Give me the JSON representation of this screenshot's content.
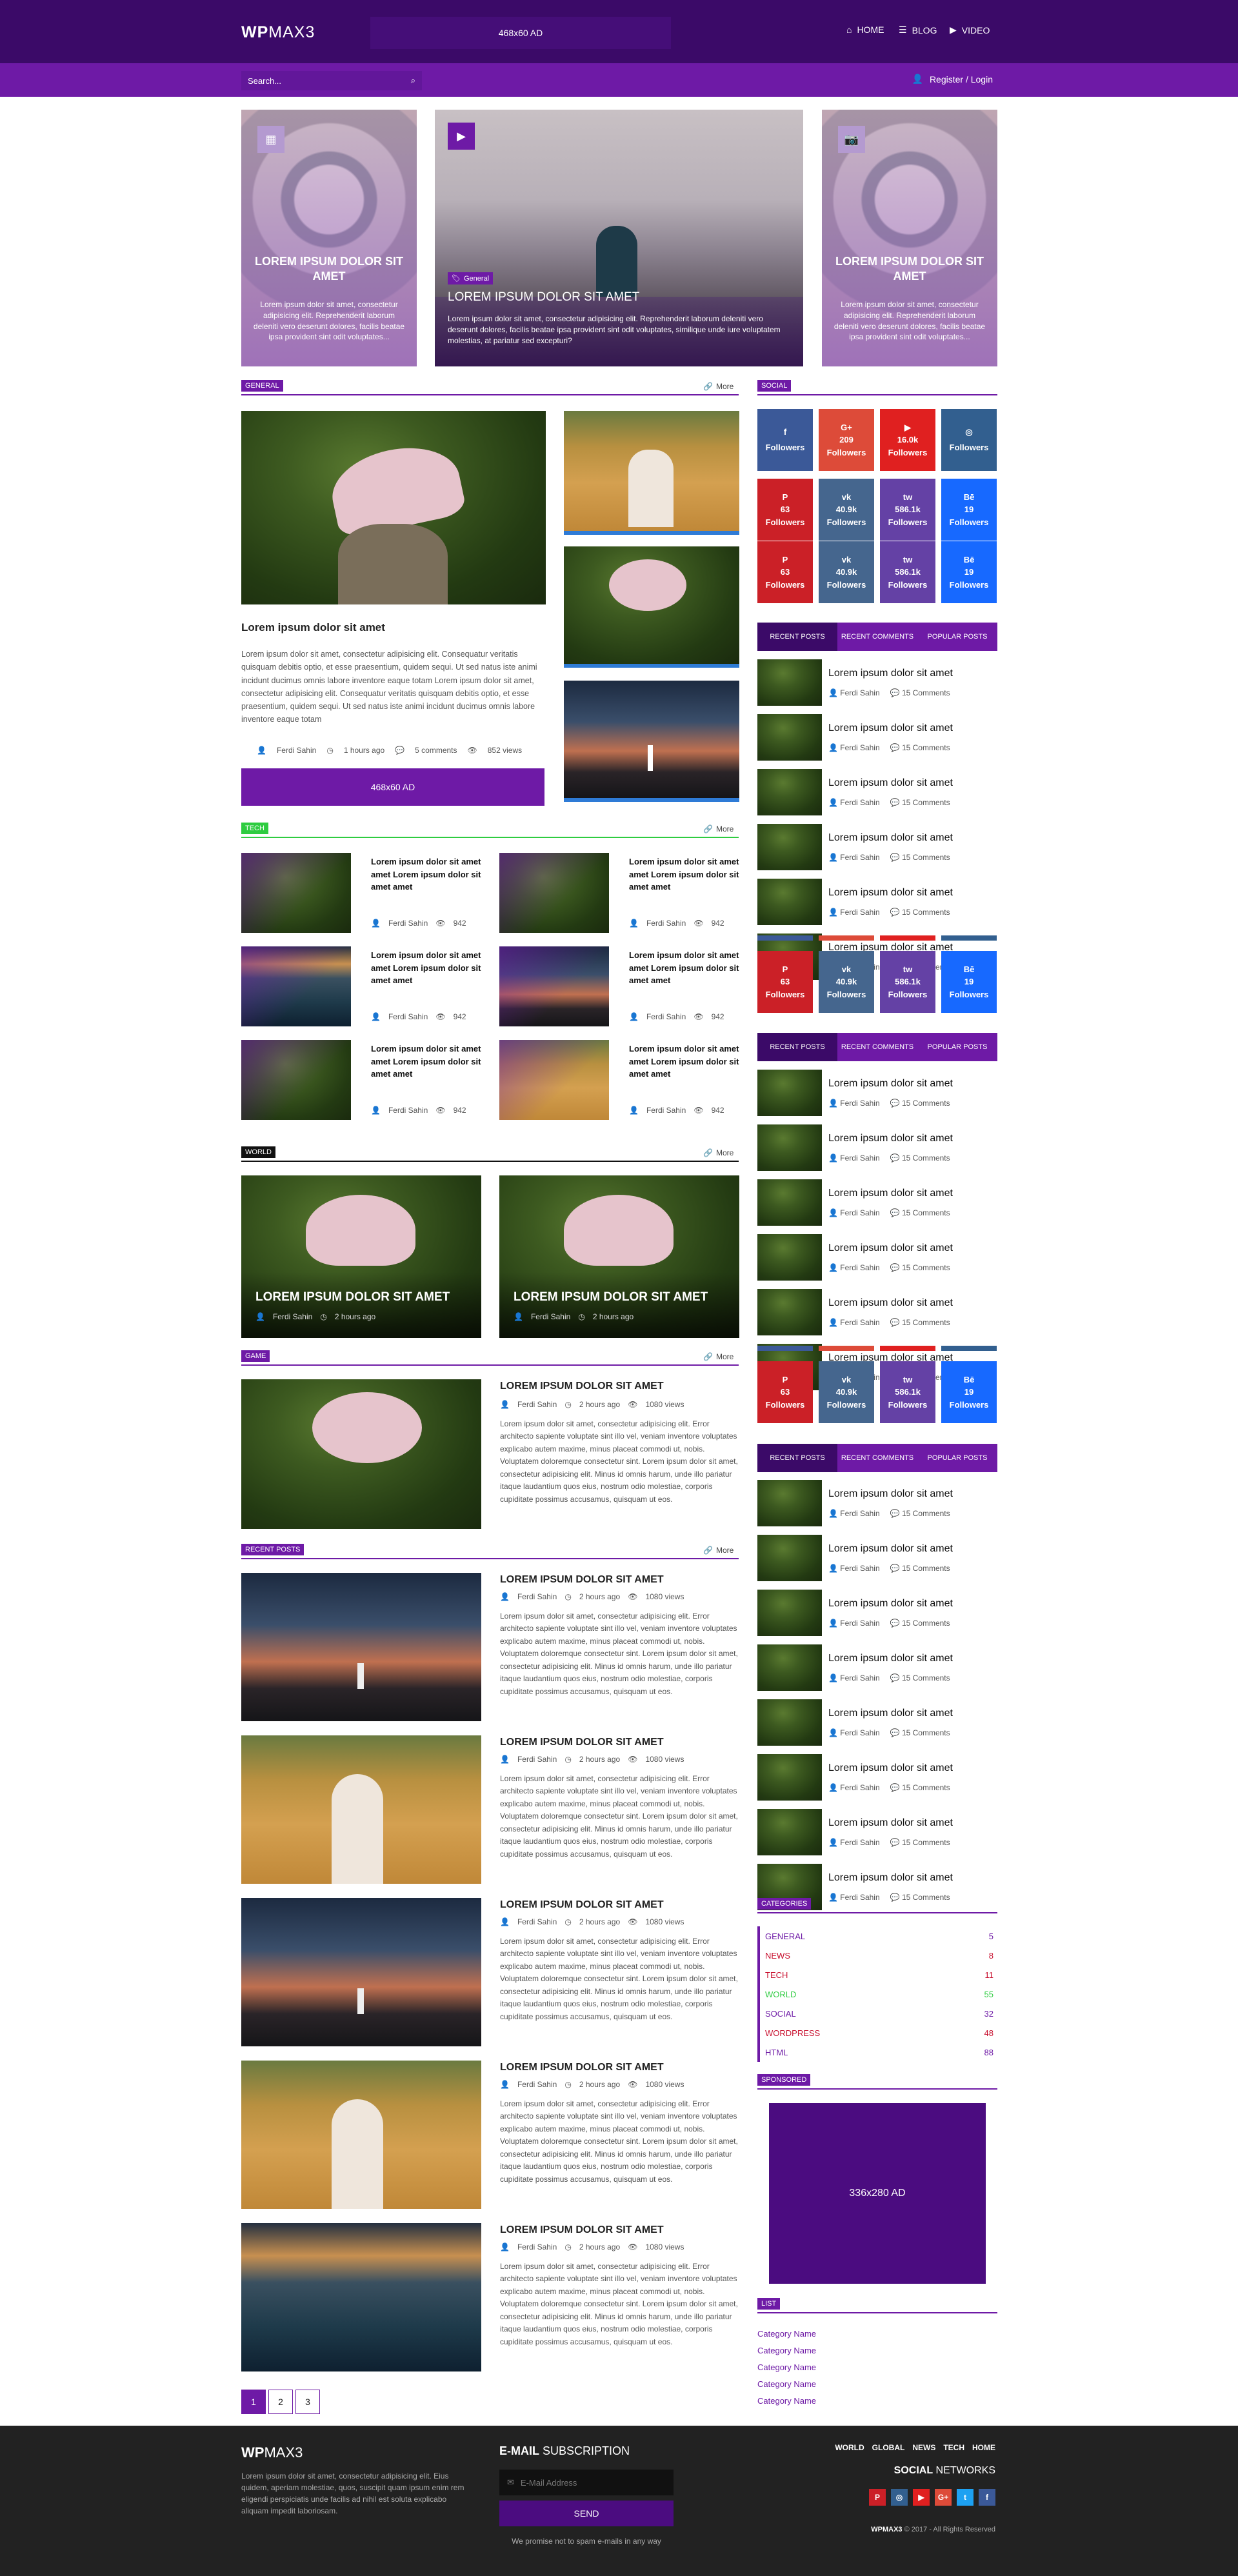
{
  "header": {
    "logo_bold": "WP",
    "logo_light": "MAX3",
    "ad": "468x60 AD",
    "nav": [
      "HOME",
      "BLOG",
      "VIDEO"
    ],
    "search_placeholder": "Search...",
    "login": "Register / Login"
  },
  "hero": {
    "left": {
      "title": "LOREM IPSUM DOLOR SIT AMET",
      "excerpt": "Lorem ipsum dolor sit amet, consectetur adipisicing elit. Reprehenderit laborum deleniti vero deserunt dolores, facilis beatae ipsa provident sint odit voluptates..."
    },
    "center": {
      "tag": "General",
      "title": "LOREM IPSUM DOLOR SIT AMET",
      "excerpt": "Lorem ipsum dolor sit amet, consectetur adipisicing elit. Reprehenderit laborum deleniti vero deserunt dolores, facilis beatae ipsa provident sint odit voluptates, similique unde iure voluptatem molestias, at pariatur sed excepturi?"
    },
    "right": {
      "title": "LOREM IPSUM DOLOR SIT AMET",
      "excerpt": "Lorem ipsum dolor sit amet, consectetur adipisicing elit. Reprehenderit laborum deleniti vero deserunt dolores, facilis beatae ipsa provident sint odit voluptates..."
    }
  },
  "more": "More",
  "general": {
    "label": "GENERAL",
    "title": "Lorem ipsum dolor sit amet",
    "excerpt": "Lorem ipsum dolor sit amet, consectetur adipisicing elit. Consequatur veritatis quisquam debitis optio, et esse praesentium, quidem sequi. Ut sed natus iste animi incidunt ducimus omnis labore inventore eaque totam Lorem ipsum dolor sit amet, consectetur adipisicing elit. Consequatur veritatis quisquam debitis optio, et esse praesentium, quidem sequi. Ut sed natus iste animi incidunt ducimus omnis labore inventore eaque totam",
    "author": "Ferdi Sahin",
    "time": "1 hours ago",
    "comments": "5 comments",
    "views": "852 views",
    "ad": "468x60 AD"
  },
  "tech": {
    "label": "TECH",
    "item_title": "Lorem ipsum dolor sit amet amet Lorem ipsum dolor sit amet amet",
    "author": "Ferdi Sahin",
    "views": "942"
  },
  "world": {
    "label": "WORLD",
    "title": "LOREM IPSUM DOLOR SIT AMET",
    "author": "Ferdi Sahin",
    "time": "2 hours ago"
  },
  "game": {
    "label": "GAME",
    "title": "LOREM IPSUM DOLOR SIT AMET",
    "author": "Ferdi Sahin",
    "time": "2 hours ago",
    "views": "1080 views",
    "excerpt": "Lorem ipsum dolor sit amet, consectetur adipisicing elit. Error architecto sapiente voluptate sint illo vel, veniam inventore voluptates explicabo autem maxime, minus placeat commodi ut, nobis. Voluptatem doloremque consectetur sint. Lorem ipsum dolor sit amet, consectetur adipisicing elit. Minus id omnis harum, unde illo pariatur itaque laudantium quos eius, nostrum odio molestiae, corporis cupiditate possimus accusamus, quisquam ut eos."
  },
  "recent": {
    "label": "RECENT POSTS",
    "title": "LOREM IPSUM DOLOR SIT AMET",
    "author": "Ferdi Sahin",
    "time": "2 hours ago",
    "views": "1080 views",
    "excerpt": "Lorem ipsum dolor sit amet, consectetur adipisicing elit. Error architecto sapiente voluptate sint illo vel, veniam inventore voluptates explicabo autem maxime, minus placeat commodi ut, nobis. Voluptatem doloremque consectetur sint. Lorem ipsum dolor sit amet, consectetur adipisicing elit. Minus id omnis harum, unde illo pariatur itaque laudantium quos eius, nostrum odio molestiae, corporis cupiditate possimus accusamus, quisquam ut eos."
  },
  "pagination": [
    "1",
    "2",
    "3"
  ],
  "sidebar": {
    "social_label": "SOCIAL",
    "social_row1": [
      {
        "icon": "f",
        "count": "",
        "label": "Followers",
        "color": "#3b5998"
      },
      {
        "icon": "G+",
        "count": "209",
        "label": "Followers",
        "color": "#dd4b39"
      },
      {
        "icon": "▶",
        "count": "16.0k",
        "label": "Followers",
        "color": "#e02020"
      },
      {
        "icon": "◎",
        "count": "",
        "label": "Followers",
        "color": "#325f8f"
      }
    ],
    "social_row2": [
      {
        "icon": "P",
        "count": "63",
        "label": "Followers",
        "color": "#cb2027"
      },
      {
        "icon": "vk",
        "count": "40.9k",
        "label": "Followers",
        "color": "#45668e"
      },
      {
        "icon": "tw",
        "count": "586.1k",
        "label": "Followers",
        "color": "#6441a5"
      },
      {
        "icon": "Bē",
        "count": "19",
        "label": "Followers",
        "color": "#1769ff"
      }
    ],
    "tabs": [
      "RECENT POSTS",
      "RECENT COMMENTS",
      "POPULAR POSTS"
    ],
    "rp_title": "Lorem ipsum dolor sit amet",
    "rp_author": "Ferdi Sahin",
    "rp_comments": "15 Comments",
    "categories_label": "CATEGORIES",
    "categories": [
      {
        "name": "GENERAL",
        "count": "5",
        "color": "#6e1aa6"
      },
      {
        "name": "NEWS",
        "count": "8",
        "color": "#c8102e"
      },
      {
        "name": "TECH",
        "count": "11",
        "color": "#c8102e"
      },
      {
        "name": "WORLD",
        "count": "55",
        "color": "#2ecc40"
      },
      {
        "name": "SOCIAL",
        "count": "32",
        "color": "#6e1aa6"
      },
      {
        "name": "WORDPRESS",
        "count": "48",
        "color": "#c8102e"
      },
      {
        "name": "HTML",
        "count": "88",
        "color": "#6e1aa6"
      }
    ],
    "sponsored_label": "SPONSORED",
    "sponsored_ad": "336x280 AD",
    "list_label": "LIST",
    "list": [
      "Category Name",
      "Category Name",
      "Category Name",
      "Category Name",
      "Category Name"
    ]
  },
  "footer": {
    "logo_bold": "WP",
    "logo_light": "MAX3",
    "about": "Lorem ipsum dolor sit amet, consectetur adipisicing elit. Eius quidem, aperiam molestiae, quos, suscipit quam ipsum enim rem eligendi perspiciatis unde facilis ad nihil est soluta explicabo aliquam impedit laboriosam.",
    "subscription_bold": "E-MAIL",
    "subscription_light": "SUBSCRIPTION",
    "email_placeholder": "E-Mail Address",
    "send": "SEND",
    "promise": "We promise not to spam e-mails in any way",
    "nav": [
      "WORLD",
      "GLOBAL",
      "NEWS",
      "TECH",
      "HOME"
    ],
    "social_bold": "SOCIAL",
    "social_light": "NETWORKS",
    "copyright_bold": "WPMAX3",
    "copyright_rest": "© 2017 - All Rights Reserved"
  }
}
